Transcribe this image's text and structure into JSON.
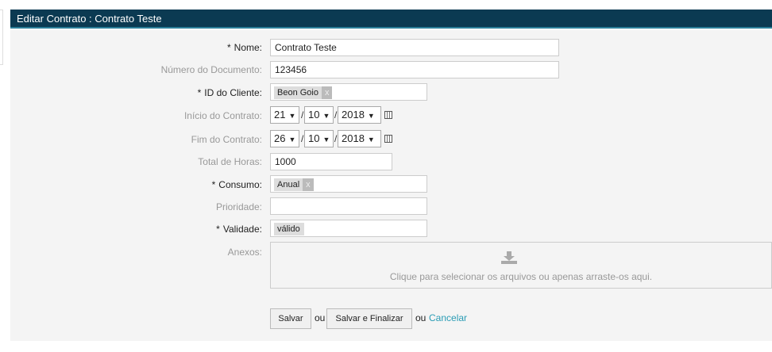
{
  "header": {
    "title": "Editar Contrato : Contrato Teste"
  },
  "form": {
    "nome": {
      "label": "Nome:",
      "value": "Contrato Teste"
    },
    "numero": {
      "label": "Número do Documento:",
      "value": "123456"
    },
    "cliente": {
      "label": "ID do Cliente:",
      "tag": "Beon Goio",
      "remove": "x"
    },
    "inicio": {
      "label": "Início do Contrato:",
      "day": "21",
      "month": "10",
      "year": "2018"
    },
    "fim": {
      "label": "Fim do Contrato:",
      "day": "26",
      "month": "10",
      "year": "2018"
    },
    "horas": {
      "label": "Total de Horas:",
      "value": "1000"
    },
    "consumo": {
      "label": "Consumo:",
      "tag": "Anual",
      "remove": "x"
    },
    "prioridade": {
      "label": "Prioridade:",
      "value": ""
    },
    "validade": {
      "label": "Validade:",
      "tag": "válido"
    },
    "anexos": {
      "label": "Anexos:",
      "dropzone": "Clique para selecionar os arquivos ou apenas arraste-os aqui."
    },
    "required_mark": "*",
    "separator": "/",
    "arrow": "▼"
  },
  "actions": {
    "save": "Salvar",
    "or1": "ou",
    "save_finish": "Salvar e Finalizar",
    "or2": "ou",
    "cancel": "Cancelar"
  }
}
